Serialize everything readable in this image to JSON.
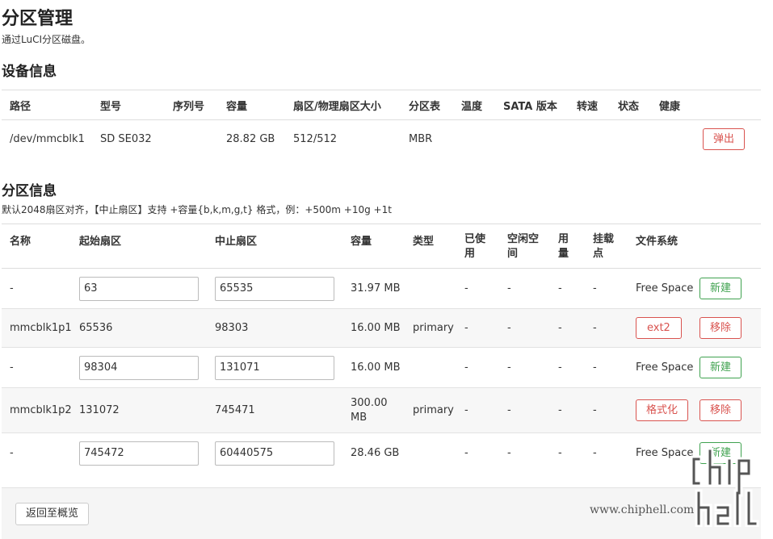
{
  "page": {
    "title": "分区管理",
    "description": "通过LuCI分区磁盘。"
  },
  "device_section": {
    "title": "设备信息",
    "headers": [
      "路径",
      "型号",
      "序列号",
      "容量",
      "扇区/物理扇区大小",
      "分区表",
      "温度",
      "SATA 版本",
      "转速",
      "状态",
      "健康"
    ],
    "row": {
      "path": "/dev/mmcblk1",
      "model": "SD SE032",
      "serial": "",
      "capacity": "28.82 GB",
      "sector_size": "512/512",
      "table": "MBR",
      "temp": "",
      "sata": "",
      "rpm": "",
      "status": "",
      "health": "",
      "eject_label": "弹出"
    }
  },
  "partition_section": {
    "title": "分区信息",
    "description": "默认2048扇区对齐，【中止扇区】支持 +容量{b,k,m,g,t} 格式，例：+500m +10g +1t",
    "headers": {
      "name": "名称",
      "start": "起始扇区",
      "end": "中止扇区",
      "size": "容量",
      "type": "类型",
      "used_1": "已使",
      "used_2": "用",
      "free_1": "空闲空",
      "free_2": "间",
      "usage_1": "用",
      "usage_2": "量",
      "mount_1": "挂载",
      "mount_2": "点",
      "fs": "文件系统"
    },
    "rows": [
      {
        "name": "-",
        "start": "63",
        "end": "65535",
        "size": "31.97 MB",
        "type": "",
        "used": "-",
        "free": "-",
        "usage": "-",
        "mount": "-",
        "fs": "Free Space",
        "action": "新建"
      },
      {
        "name": "mmcblk1p1",
        "start": "65536",
        "end": "98303",
        "size": "16.00 MB",
        "type": "primary",
        "used": "-",
        "free": "-",
        "usage": "-",
        "mount": "-",
        "fs_button": "ext2",
        "action": "移除"
      },
      {
        "name": "-",
        "start": "98304",
        "end": "131071",
        "size": "16.00 MB",
        "type": "",
        "used": "-",
        "free": "-",
        "usage": "-",
        "mount": "-",
        "fs": "Free Space",
        "action": "新建"
      },
      {
        "name": "mmcblk1p2",
        "start": "131072",
        "end": "745471",
        "size_1": "300.00",
        "size_2": "MB",
        "type": "primary",
        "used": "-",
        "free": "-",
        "usage": "-",
        "mount": "-",
        "fs_button": "格式化",
        "action": "移除"
      },
      {
        "name": "-",
        "start": "745472",
        "end": "60440575",
        "size": "28.46 GB",
        "type": "",
        "used": "-",
        "free": "-",
        "usage": "-",
        "mount": "-",
        "fs": "Free Space",
        "action": "新建"
      }
    ]
  },
  "footer": {
    "back_label": "返回至概览"
  },
  "watermark": {
    "text": "www.chiphell.com"
  }
}
